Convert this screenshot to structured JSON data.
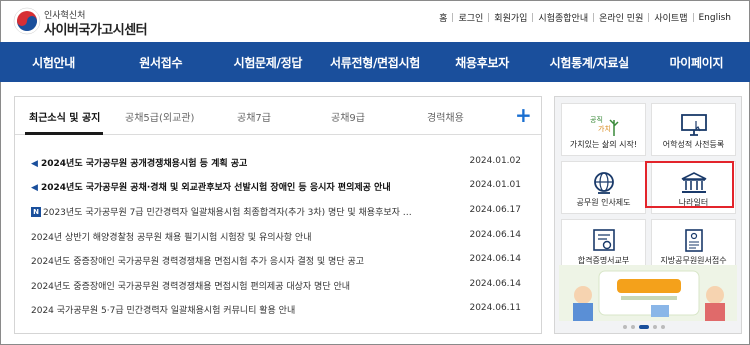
{
  "header": {
    "logo_small": "인사혁신처",
    "logo_big": "사이버국가고시센터",
    "util_links": [
      "홈",
      "로그인",
      "회원가입",
      "시험종합안내",
      "온라인 민원",
      "사이트맵",
      "English"
    ]
  },
  "nav": {
    "items": [
      "시험안내",
      "원서접수",
      "시험문제/정답",
      "서류전형/면접시험",
      "채용후보자",
      "시험통계/자료실",
      "마이페이지"
    ]
  },
  "news": {
    "tabs": [
      "최근소식 및 공지",
      "공채5급(외교관)",
      "공채7급",
      "공채9급",
      "경력채용"
    ],
    "plus": "+",
    "rows": [
      {
        "title": "2024년도 국가공무원 공개경쟁채용시험 등 계획 공고",
        "date": "2024.01.02",
        "bold": true,
        "icon": "speaker-icon"
      },
      {
        "title": "2024년도 국가공무원 공채·경채 및 외교관후보자 선발시험 장애인 등 응시자 편의제공 안내",
        "date": "2024.01.01",
        "bold": true,
        "icon": "speaker-icon"
      },
      {
        "title": "2023년도 국가공무원 7급 민간경력자 일괄채용시험 최종합격자(추가 3차) 명단 및 채용후보자 …",
        "date": "2024.06.17",
        "bold": false,
        "icon": "new-badge-icon",
        "badge": "N"
      },
      {
        "title": "2024년 상반기 해양경찰청 공무원 채용 필기시험 시험장 및 유의사항 안내",
        "date": "2024.06.14",
        "bold": false,
        "icon": ""
      },
      {
        "title": "2024년도 중증장애인 국가공무원 경력경쟁채용 면접시험 추가 응시자 결정 및 명단 공고",
        "date": "2024.06.14",
        "bold": false,
        "icon": ""
      },
      {
        "title": "2024년도 중증장애인 국가공무원 경력경쟁채용 면접시험 편의제공 대상자 명단 안내",
        "date": "2024.06.14",
        "bold": false,
        "icon": ""
      },
      {
        "title": "2024 국가공무원 5·7급 민간경력자 일괄채용시험 커뮤니티 활용 안내",
        "date": "2024.06.11",
        "bold": false,
        "icon": ""
      }
    ]
  },
  "quick": {
    "cards": [
      {
        "label": "가치있는 삶의 시작!",
        "icon": "value-life-icon"
      },
      {
        "label": "어학성적 사전등록",
        "icon": "monitor-pointer-icon"
      },
      {
        "label": "공무원 인사제도",
        "icon": "globe-icon"
      },
      {
        "label": "나라일터",
        "icon": "government-building-icon"
      },
      {
        "label": "합격증명서교부",
        "icon": "certificate-icon"
      },
      {
        "label": "지방공무원원서접수",
        "icon": "document-icon"
      }
    ],
    "banner_icon": "promo-banner",
    "accent": "#1a4f9c",
    "highlight_color": "#e3242b"
  }
}
